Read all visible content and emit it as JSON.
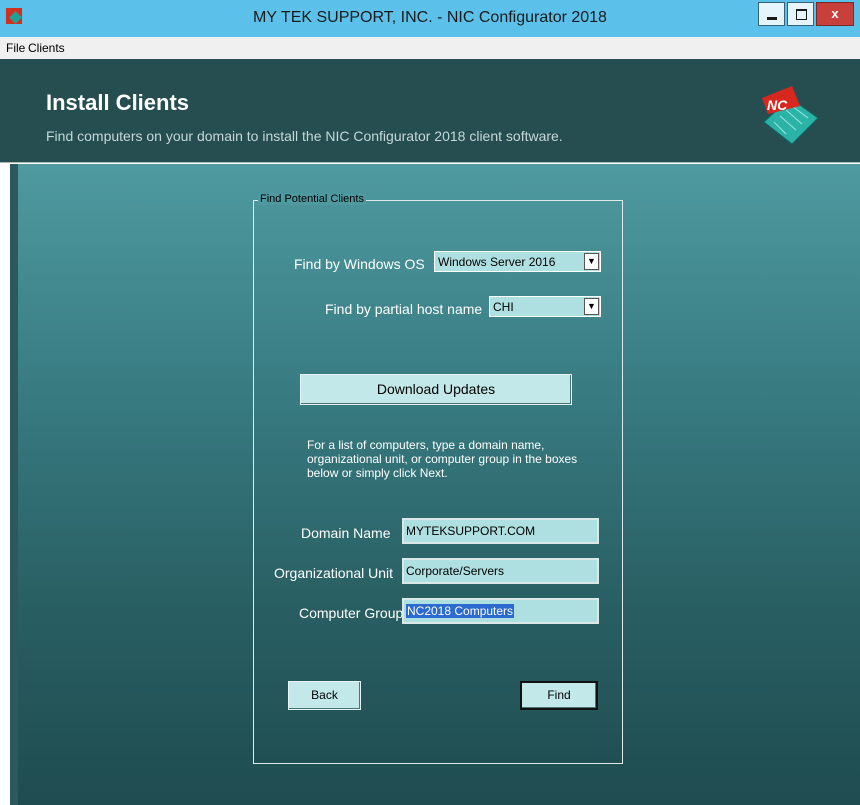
{
  "window": {
    "title": "MY TEK SUPPORT, INC. - NIC Configurator 2018",
    "close_label": "x"
  },
  "menu": {
    "items": [
      "File",
      "Clients"
    ]
  },
  "header": {
    "title": "Install Clients",
    "subtitle": "Find computers on your domain to install the NIC Configurator 2018 client software.",
    "logo_text": "NC"
  },
  "group": {
    "legend": "Find Potential Clients",
    "os_label": "Find by Windows OS",
    "os_value": "Windows Server 2016",
    "host_label": "Find by partial host name",
    "host_value": "CHI",
    "download_label": "Download Updates",
    "help_text": "For a list of computers, type a domain name, organizational unit, or computer group in the boxes below or simply click Next.",
    "domain_label": "Domain Name",
    "domain_value": "MYTEKSUPPORT.COM",
    "ou_label": "Organizational Unit",
    "ou_value": "Corporate/Servers",
    "group_label": "Computer Group",
    "group_value": "NC2018 Computers",
    "back_label": "Back",
    "find_label": "Find"
  }
}
